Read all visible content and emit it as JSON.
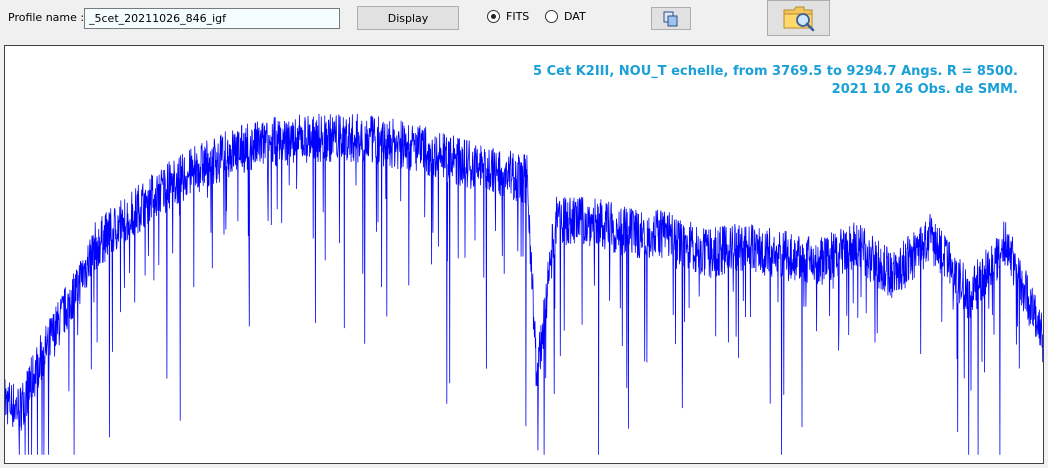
{
  "toolbar": {
    "profile_label": "Profile name :",
    "profile_value": "_5cet_20211026_846_igf",
    "display_label": "Display",
    "format_options": [
      "FITS",
      "DAT"
    ],
    "format_selected": "FITS"
  },
  "plot": {
    "caption_line1": "5 Cet K2III, NOU_T echelle, from 3769.5 to 9294.7 Angs. R = 8500.",
    "caption_line2": "2021 10 26 Obs. de SMM.",
    "line_color": "#0000ff",
    "caption_color": "#1a9fd6"
  },
  "chart_data": {
    "type": "line",
    "xlim": [
      3769.5,
      9294.7
    ],
    "ylim": [
      0,
      1
    ],
    "grid": false,
    "series": [
      {
        "envelope_x": [
          3769.5,
          3850,
          3950,
          4050,
          4150,
          4250,
          4400,
          4550,
          4700,
          4850,
          5000,
          5200,
          5400,
          5600,
          5800,
          6000,
          6200,
          6400,
          6550,
          6600,
          6700,
          6900,
          7100,
          7300,
          7500,
          7700,
          7900,
          8100,
          8300,
          8500,
          8700,
          8900,
          9100,
          9294.7
        ],
        "envelope_y": [
          0.15,
          0.13,
          0.24,
          0.33,
          0.42,
          0.52,
          0.58,
          0.64,
          0.68,
          0.72,
          0.75,
          0.77,
          0.78,
          0.78,
          0.77,
          0.75,
          0.72,
          0.7,
          0.68,
          0.2,
          0.58,
          0.58,
          0.55,
          0.55,
          0.5,
          0.52,
          0.5,
          0.48,
          0.52,
          0.45,
          0.54,
          0.4,
          0.53,
          0.3
        ]
      }
    ]
  }
}
